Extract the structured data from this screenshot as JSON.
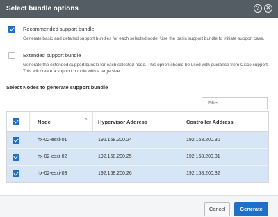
{
  "dialog": {
    "title": "Select bundle options",
    "help_icon": "help-circle-icon",
    "close_icon": "close-circle-icon"
  },
  "options": [
    {
      "label": "Recommended support bundle",
      "checked": true,
      "description": "Generate basic and detailed support bundles for each selected node. Use the basic support bundle to initiate support case."
    },
    {
      "label": "Extended support bundle",
      "checked": false,
      "description": "Generate the extended support bundle for each selected node. This option should be used with guidance from Cisco support. This will create a support bundle with a large size."
    }
  ],
  "nodes_section": {
    "title": "Select Nodes to generate support bundle",
    "filter_placeholder": "Filter",
    "columns": [
      "Node",
      "Hypervisor Address",
      "Controller Address"
    ],
    "header_checked": true,
    "rows": [
      {
        "node": "hx-02-esxi-01",
        "hypervisor": "192.168.200.24",
        "controller": "192.168.200.30",
        "checked": true
      },
      {
        "node": "hx-02-esxi-02",
        "hypervisor": "192.168.200.25",
        "controller": "192.168.200.31",
        "checked": true
      },
      {
        "node": "hx-02-esxi-03",
        "hypervisor": "192.168.200.26",
        "controller": "192.168.200.32",
        "checked": true
      }
    ]
  },
  "footer": {
    "cancel_label": "Cancel",
    "generate_label": "Generate"
  },
  "colors": {
    "header_bg": "#555d64",
    "accent": "#1e6fc7",
    "selected_row": "#d7e6f6"
  }
}
